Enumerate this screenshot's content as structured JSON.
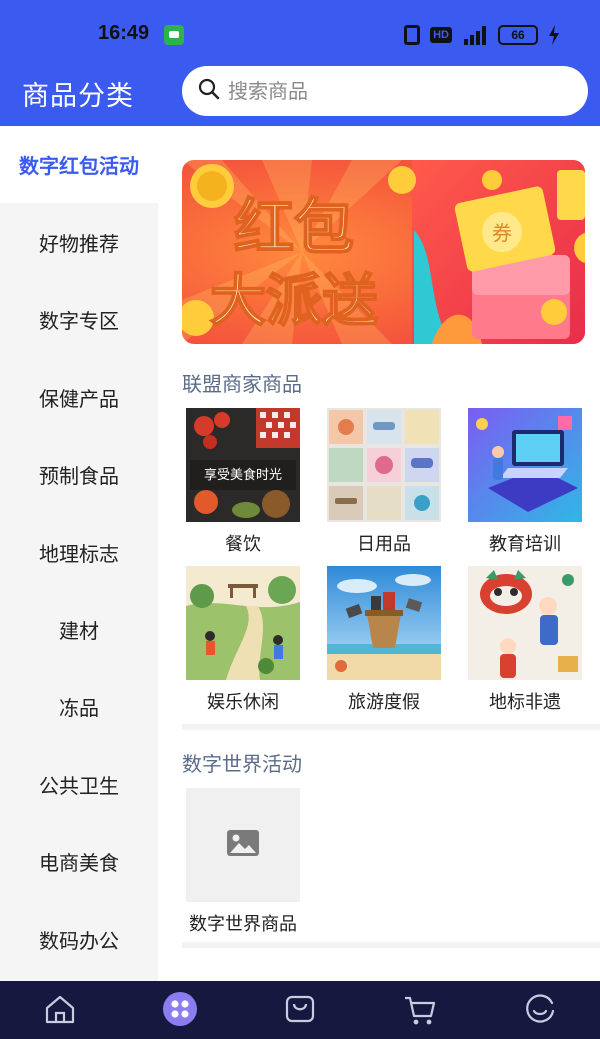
{
  "status_bar": {
    "time": "16:49",
    "battery": "66"
  },
  "header": {
    "title": "商品分类",
    "search_placeholder": "搜索商品"
  },
  "sidebar": {
    "items": [
      {
        "label": "数字红包活动",
        "active": true
      },
      {
        "label": "好物推荐",
        "active": false
      },
      {
        "label": "数字专区",
        "active": false
      },
      {
        "label": "保健产品",
        "active": false
      },
      {
        "label": "预制食品",
        "active": false
      },
      {
        "label": "地理标志",
        "active": false
      },
      {
        "label": "建材",
        "active": false
      },
      {
        "label": "冻品",
        "active": false
      },
      {
        "label": "公共卫生",
        "active": false
      },
      {
        "label": "电商美食",
        "active": false
      },
      {
        "label": "数码办公",
        "active": false
      }
    ]
  },
  "main": {
    "banner": {
      "line1": "红包",
      "line2": "大派送",
      "coupon_text": "券"
    },
    "alliance": {
      "title": "联盟商家商品",
      "items": [
        {
          "label": "餐饮",
          "overlay": "享受美食时光",
          "icon": "food-image"
        },
        {
          "label": "日用品",
          "icon": "daily-goods-image"
        },
        {
          "label": "教育培训",
          "icon": "education-image"
        },
        {
          "label": "娱乐休闲",
          "icon": "leisure-image"
        },
        {
          "label": "旅游度假",
          "icon": "travel-image"
        },
        {
          "label": "地标非遗",
          "icon": "heritage-image"
        }
      ]
    },
    "digital_world": {
      "title": "数字世界活动",
      "items": [
        {
          "label": "数字世界商品",
          "icon": "image-placeholder-icon"
        }
      ]
    }
  },
  "colors": {
    "primary": "#3b5bf0",
    "sidebar_bg": "#f5f5f5",
    "tabbar_bg": "#16183f",
    "section_title": "#5b6c8a"
  }
}
